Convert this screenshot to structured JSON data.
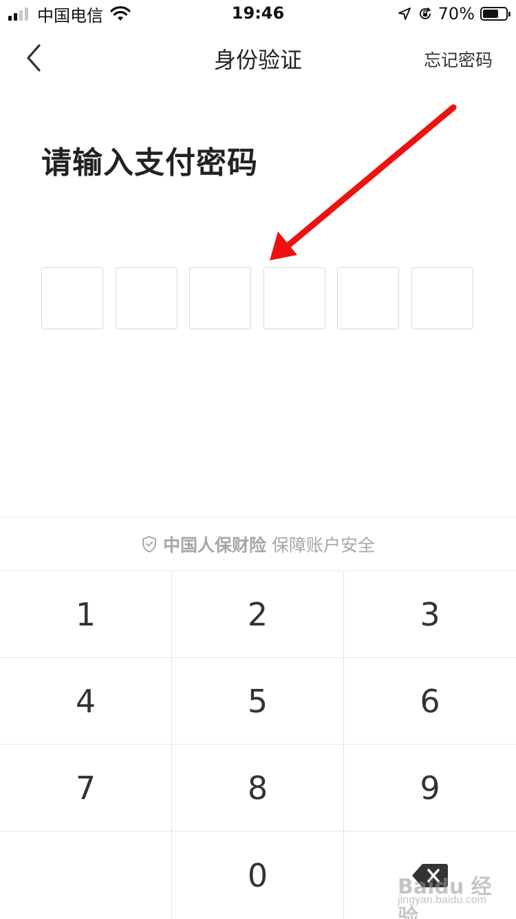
{
  "status_bar": {
    "carrier": "中国电信",
    "time": "19:46",
    "battery_percent_text": "70%",
    "battery_level": 0.7,
    "icons": [
      "signal-icon",
      "wifi-icon",
      "location-icon",
      "rotation-lock-icon",
      "battery-icon"
    ]
  },
  "nav": {
    "title": "身份验证",
    "forgot_label": "忘记密码",
    "back_icon": "chevron-left-icon"
  },
  "main": {
    "heading": "请输入支付密码",
    "pin_length": 6
  },
  "security": {
    "icon": "shield-check-icon",
    "brand": "中国人保财险",
    "text": "保障账户安全"
  },
  "keypad": {
    "keys": [
      "1",
      "2",
      "3",
      "4",
      "5",
      "6",
      "7",
      "8",
      "9",
      "",
      "0",
      ""
    ],
    "delete_icon": "backspace-icon"
  },
  "watermark": {
    "text": "Baidu 经验",
    "url_text": "jingyan.baidu.com"
  },
  "colors": {
    "annotation_arrow": "#ee1111",
    "muted_text": "#a6a6a6",
    "divider": "#e6e6e6"
  }
}
